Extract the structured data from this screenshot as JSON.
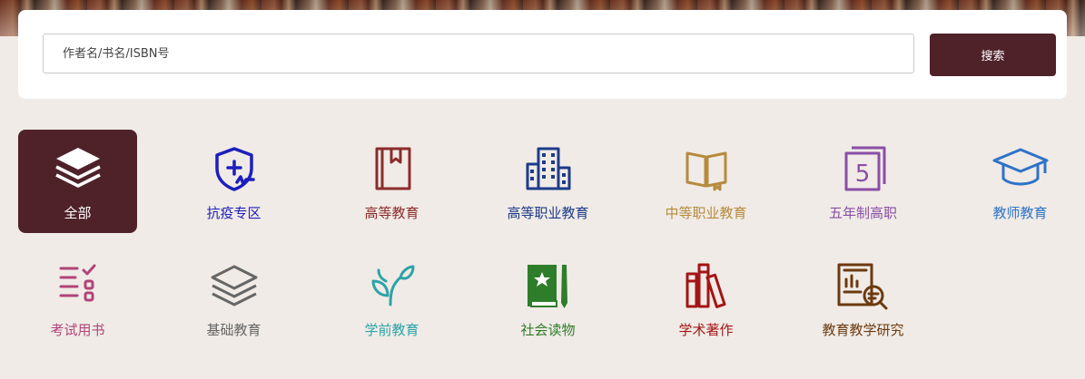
{
  "search": {
    "placeholder": "作者名/书名/ISBN号",
    "button_label": "搜索"
  },
  "categories": [
    {
      "label": "全部",
      "icon": "layers-icon",
      "color": "#ffffff",
      "active": true
    },
    {
      "label": "抗疫专区",
      "icon": "shield-medical-icon",
      "color": "#1c1fbd"
    },
    {
      "label": "高等教育",
      "icon": "book-bookmark-icon",
      "color": "#8b2c2c"
    },
    {
      "label": "高等职业教育",
      "icon": "building-icon",
      "color": "#1d3b8a"
    },
    {
      "label": "中等职业教育",
      "icon": "open-book-icon",
      "color": "#b58b3e"
    },
    {
      "label": "五年制高职",
      "icon": "number-five-icon",
      "color": "#8a4ea6"
    },
    {
      "label": "教师教育",
      "icon": "graduation-cap-icon",
      "color": "#2f73c8"
    },
    {
      "label": "考试用书",
      "icon": "checklist-icon",
      "color": "#b0447a"
    },
    {
      "label": "基础教育",
      "icon": "stack-icon",
      "color": "#666666"
    },
    {
      "label": "学前教育",
      "icon": "sprout-icon",
      "color": "#2ca3a8"
    },
    {
      "label": "社会读物",
      "icon": "star-book-icon",
      "color": "#2e7d2a"
    },
    {
      "label": "学术著作",
      "icon": "books-icon",
      "color": "#a31515"
    },
    {
      "label": "教育教学研究",
      "icon": "research-icon",
      "color": "#6b3a10"
    }
  ]
}
